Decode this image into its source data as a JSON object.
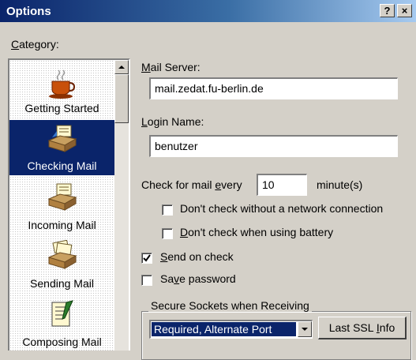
{
  "window": {
    "title": "Options",
    "help_label": "?",
    "close_label": "×"
  },
  "category": {
    "label": "Category:",
    "items": [
      {
        "label": "Getting Started",
        "icon": "coffee-cup-icon",
        "selected": false
      },
      {
        "label": "Checking Mail",
        "icon": "mailbox-tray-icon",
        "selected": true
      },
      {
        "label": "Incoming Mail",
        "icon": "incoming-tray-icon",
        "selected": false
      },
      {
        "label": "Sending Mail",
        "icon": "outgoing-tray-icon",
        "selected": false
      },
      {
        "label": "Composing Mail",
        "icon": "document-icon",
        "selected": false
      }
    ]
  },
  "mail_server": {
    "label": "Mail Server:",
    "value": "mail.zedat.fu-berlin.de"
  },
  "login_name": {
    "label": "Login Name:",
    "value": "benutzer"
  },
  "check_interval": {
    "label": "Check for mail every",
    "value": "10",
    "unit": "minute(s)"
  },
  "options": [
    {
      "label": "Don't check without a network connection",
      "checked": false
    },
    {
      "label": "Don't check when using battery",
      "checked": false
    },
    {
      "label": "Send on check",
      "checked": true
    },
    {
      "label": "Save password",
      "checked": false
    }
  ],
  "ssl": {
    "group_label": "Secure Sockets when Receiving",
    "selected": "Required, Alternate Port",
    "button_label": "Last SSL Info"
  }
}
